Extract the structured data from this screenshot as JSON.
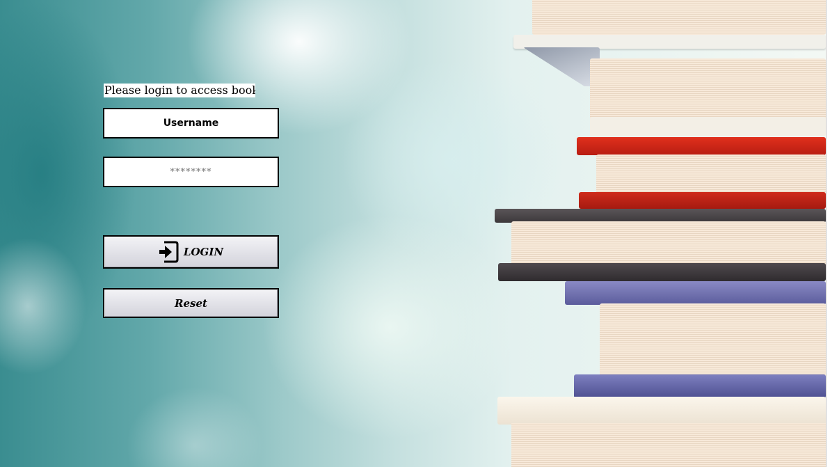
{
  "login_form": {
    "prompt": "Please login to access books",
    "username_value": "Username",
    "password_placeholder": "********",
    "login_button_label": "LOGIN",
    "login_button_icon": "login-icon",
    "reset_button_label": "Reset"
  }
}
